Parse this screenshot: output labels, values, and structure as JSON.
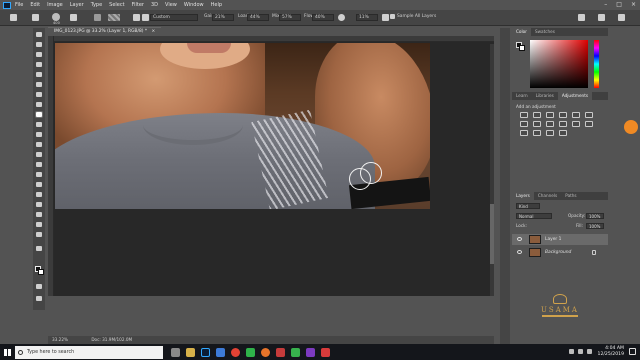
{
  "menubar": {
    "items": [
      "File",
      "Edit",
      "Image",
      "Layer",
      "Type",
      "Select",
      "Filter",
      "3D",
      "View",
      "Window",
      "Help"
    ],
    "window_controls": [
      "–",
      "□",
      "×"
    ]
  },
  "optionsbar": {
    "brush_size": "400",
    "mode_value": "Custom",
    "gain_label": "Gain:",
    "gain_value": "21%",
    "load_label": "Load:",
    "load_value": "44%",
    "mix_label": "Mix:",
    "mix_value": "57%",
    "flow_label": "Flow:",
    "flow_value": "40%",
    "smoothing_value": "11%",
    "sample_all_layers": "Sample All Layers"
  },
  "document": {
    "tab_title": "IMG_0123.JPG @ 33.2% (Layer 1, RGB/8) *",
    "tab_close": "×",
    "zoom": "33.22%",
    "doc_info": "Doc: 31.9M/102.0M"
  },
  "panels": {
    "color_tabs": [
      "Color",
      "Swatches"
    ],
    "adjust_tabs": [
      "Learn",
      "Libraries",
      "Adjustments"
    ],
    "add_adjustment": "Add an adjustment",
    "layers_tabs": [
      "Layers",
      "Channels",
      "Paths"
    ],
    "kind_label": "Kind",
    "blend_mode": "Normal",
    "opacity_label": "Opacity:",
    "opacity_value": "100%",
    "lock_label": "Lock:",
    "fill_label": "Fill:",
    "fill_value": "100%",
    "layers": [
      {
        "name": "Layer 1",
        "selected": true
      },
      {
        "name": "Background",
        "selected": false
      }
    ]
  },
  "watermark": {
    "text": "USAMA"
  },
  "taskbar": {
    "search_placeholder": "Type here to search",
    "time": "4:04 AM",
    "date": "12/25/2019"
  },
  "colors": {
    "photoshop_blue": "#31a8ff",
    "logo_gold": "#d0a24c",
    "badge_orange": "#f08a24"
  }
}
